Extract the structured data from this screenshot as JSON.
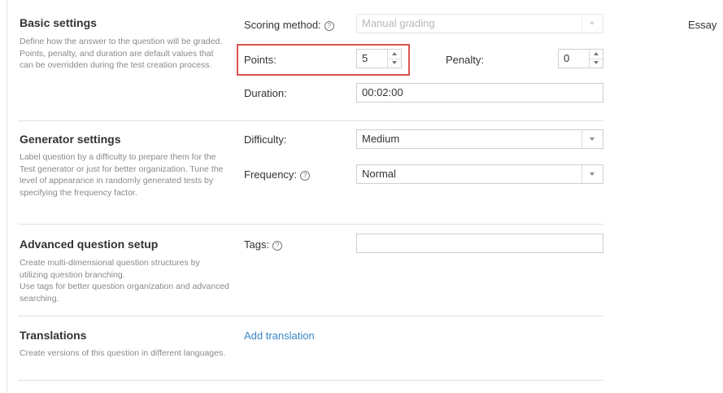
{
  "header": {
    "question_type": "Essay"
  },
  "basic": {
    "title": "Basic settings",
    "desc": "Define how the answer to the question will be graded. Points, penalty, and duration are default values that can be overridden during the test creation process.",
    "scoring_label": "Scoring method:",
    "scoring_value": "Manual grading",
    "points_label": "Points:",
    "points_value": "5",
    "penalty_label": "Penalty:",
    "penalty_value": "0",
    "duration_label": "Duration:",
    "duration_value": "00:02:00"
  },
  "generator": {
    "title": "Generator settings",
    "desc": "Label question by a difficulty to prepare them for the Test generator or just for better organization. Tune the level of appearance in randomly generated tests by specifying the frequency factor.",
    "difficulty_label": "Difficulty:",
    "difficulty_value": "Medium",
    "frequency_label": "Frequency:",
    "frequency_value": "Normal"
  },
  "advanced": {
    "title": "Advanced question setup",
    "desc1": "Create multi-dimensional question structures by utilizing question branching.",
    "desc2": "Use tags for better question organization and advanced searching.",
    "tags_label": "Tags:",
    "tags_value": ""
  },
  "translations": {
    "title": "Translations",
    "desc": "Create versions of this question in different languages.",
    "add_link": "Add translation"
  },
  "icons": {
    "help": "question-circle-icon",
    "dropdown": "caret-down-icon",
    "spinner_up": "arrow-up-icon",
    "spinner_down": "arrow-down-icon"
  },
  "colors": {
    "highlight": "#d9534f",
    "link": "#3a87c8"
  }
}
